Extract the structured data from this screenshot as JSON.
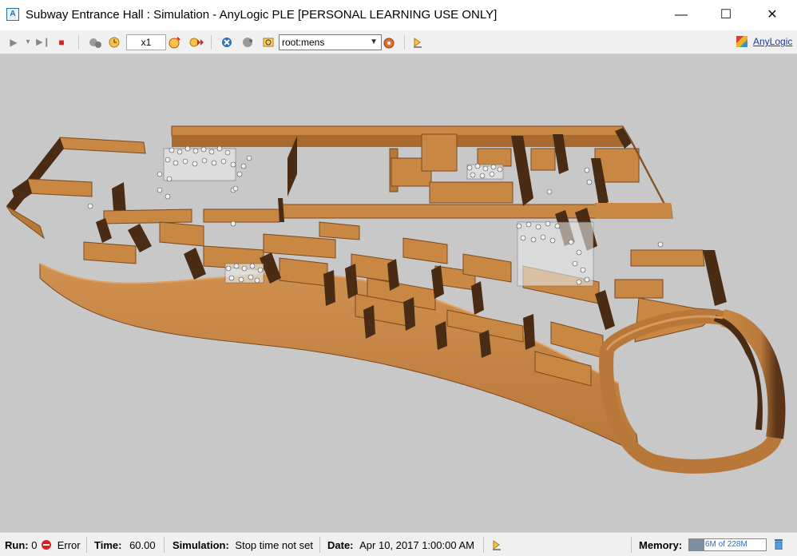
{
  "window": {
    "title": "Subway Entrance Hall : Simulation - AnyLogic PLE [PERSONAL LEARNING USE ONLY]",
    "app_icon": "anylogic-icon",
    "minimize": "—",
    "maximize": "☐",
    "close": "✕"
  },
  "toolbar": {
    "run_icon": "▶",
    "run_menu_icon": "▾",
    "step_icon": "▶❙",
    "stop_icon": "■",
    "speed": "x1",
    "view": "root:mens",
    "brand_link": "AnyLogic",
    "icons": [
      "play-icon",
      "play-dropdown-icon",
      "step-icon",
      "stop-icon",
      "slow-down-icon",
      "real-time-icon",
      "speed-up-icon",
      "fast-forward-icon",
      "experiment-icon",
      "navigate-icon",
      "view-area-icon",
      "view-dropdown-icon",
      "focus-icon",
      "developer-panel-icon"
    ]
  },
  "status": {
    "run_label": "Run:",
    "run_value": "0",
    "error_text": "Error",
    "time_label": "Time:",
    "time_value": "60.00",
    "simulation_label": "Simulation:",
    "simulation_value": "Stop time not set",
    "date_label": "Date:",
    "date_value": "Apr 10, 2017 1:00:00 AM",
    "memory_label": "Memory:",
    "memory_value": "6M of 228M",
    "memory_fraction": 0.2
  },
  "colors": {
    "wall_top": "#c88843",
    "wall_face": "#b8783a",
    "wall_shadow": "#4a2c14",
    "floor": "#c8c8c8",
    "accent": "#1c6fb4"
  }
}
